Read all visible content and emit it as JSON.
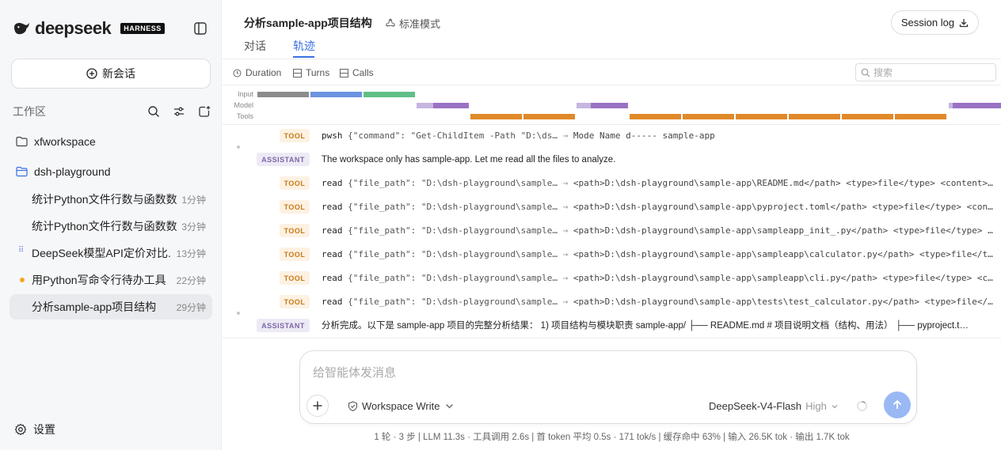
{
  "brand": {
    "name": "deepseek",
    "badge": "HARNESS"
  },
  "sidebar": {
    "new_chat": "新会话",
    "workspace_title": "工作区",
    "folders": [
      "xfworkspace",
      "dsh-playground"
    ],
    "tasks": [
      {
        "label": "统计Python文件行数与函数数",
        "time": "1分钟",
        "status": "none"
      },
      {
        "label": "统计Python文件行数与函数数",
        "time": "3分钟",
        "status": "none"
      },
      {
        "label": "DeepSeek模型API定价对比...",
        "time": "13分钟",
        "status": "running"
      },
      {
        "label": "用Python写命令行待办工具",
        "time": "22分钟",
        "status": "unread"
      },
      {
        "label": "分析sample-app项目结构",
        "time": "29分钟",
        "status": "active"
      }
    ],
    "settings": "设置"
  },
  "header": {
    "title": "分析sample-app项目结构",
    "mode": "标准模式",
    "session_log": "Session log",
    "tabs": [
      "对话",
      "轨迹"
    ],
    "active_tab": "轨迹"
  },
  "toolbar": {
    "metrics": [
      "Duration",
      "Turns",
      "Calls"
    ],
    "search_placeholder": "搜索"
  },
  "timeline": {
    "lanes": [
      "Input",
      "Model",
      "Tools"
    ],
    "colors": {
      "input_gray": "#8c8c8c",
      "input_blue": "#6b93e0",
      "input_green": "#5fbf86",
      "model_light": "#c6b6e0",
      "model": "#9a73c4",
      "tools": "#e08a2a"
    }
  },
  "trace": [
    {
      "kind": "TOOL",
      "cmd": "pwsh",
      "args": "{\"command\": \"Get-ChildItem -Path \"D:\\ds…",
      "out": "Mode Name d----- sample-app"
    },
    {
      "kind": "ASSISTANT",
      "text": "The workspace only has sample-app. Let me read all the files to analyze."
    },
    {
      "kind": "TOOL",
      "cmd": "read",
      "args": "{\"file_path\": \"D:\\dsh-playground\\sample…",
      "out": "<path>D:\\dsh-playground\\sample-app\\README.md</path> <type>file</type> <content>…"
    },
    {
      "kind": "TOOL",
      "cmd": "read",
      "args": "{\"file_path\": \"D:\\dsh-playground\\sample…",
      "out": "<path>D:\\dsh-playground\\sample-app\\pyproject.toml</path> <type>file</type> <con…"
    },
    {
      "kind": "TOOL",
      "cmd": "read",
      "args": "{\"file_path\": \"D:\\dsh-playground\\sample…",
      "out": "<path>D:\\dsh-playground\\sample-app\\sampleapp_init_.py</path> <type>file</type> …"
    },
    {
      "kind": "TOOL",
      "cmd": "read",
      "args": "{\"file_path\": \"D:\\dsh-playground\\sample…",
      "out": "<path>D:\\dsh-playground\\sample-app\\sampleapp\\calculator.py</path> <type>file</t…"
    },
    {
      "kind": "TOOL",
      "cmd": "read",
      "args": "{\"file_path\": \"D:\\dsh-playground\\sample…",
      "out": "<path>D:\\dsh-playground\\sample-app\\sampleapp\\cli.py</path> <type>file</type> <c…"
    },
    {
      "kind": "TOOL",
      "cmd": "read",
      "args": "{\"file_path\": \"D:\\dsh-playground\\sample…",
      "out": "<path>D:\\dsh-playground\\sample-app\\tests\\test_calculator.py</path> <type>file</…"
    },
    {
      "kind": "ASSISTANT",
      "text": "分析完成。以下是 sample-app 项目的完整分析结果： 1) 项目结构与模块职责 sample-app/ ├── README.md # 项目说明文档（结构、用法） ├── pyproject.t…"
    }
  ],
  "composer": {
    "placeholder": "给智能体发消息",
    "permission": "Workspace Write",
    "model": "DeepSeek-V4-Flash",
    "level": "High"
  },
  "stats": "1 轮 · 3 步  |  LLM 11.3s · 工具调用 2.6s  |  首 token 平均 0.5s · 171 tok/s  |  缓存命中 63%  |  输入 26.5K tok · 输出 1.7K tok"
}
